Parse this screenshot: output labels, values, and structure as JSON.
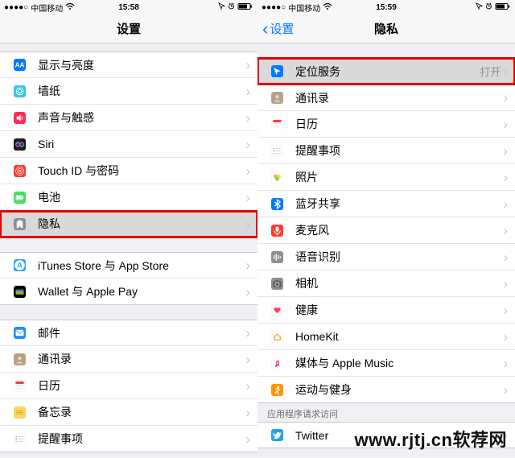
{
  "status_left": {
    "dots": "●●●●○",
    "carrier": "中国移动",
    "wifi": "wifi"
  },
  "status_right": {
    "icons": "◎ ➚ ⏰ ▮▯"
  },
  "left": {
    "time": "15:58",
    "title": "设置",
    "groups": [
      [
        {
          "icon": "display",
          "color": "#007aff",
          "label": "显示与亮度"
        },
        {
          "icon": "wallpaper",
          "color": "#38c5e6",
          "label": "墙纸"
        },
        {
          "icon": "sound",
          "color": "#ff2d55",
          "label": "声音与触感"
        },
        {
          "icon": "siri",
          "color": "grad-siri",
          "label": "Siri"
        },
        {
          "icon": "touchid",
          "color": "#ff3b30",
          "label": "Touch ID 与密码"
        },
        {
          "icon": "battery",
          "color": "#4cd964",
          "label": "电池"
        },
        {
          "icon": "privacy",
          "color": "#8e8e93",
          "label": "隐私",
          "highlight": true,
          "selected": true
        }
      ],
      [
        {
          "icon": "appstore",
          "color": "#1fa7ff",
          "label": "iTunes Store 与 App Store"
        },
        {
          "icon": "wallet",
          "color": "#000000",
          "label": "Wallet 与 Apple Pay"
        }
      ],
      [
        {
          "icon": "mail",
          "color": "#1f8ef4",
          "label": "邮件"
        },
        {
          "icon": "contacts",
          "color": "#b8a38b",
          "label": "通讯录"
        },
        {
          "icon": "calendar",
          "color": "#ffffff",
          "label": "日历"
        },
        {
          "icon": "notes",
          "color": "#fcd55f",
          "label": "备忘录"
        },
        {
          "icon": "reminders",
          "color": "#ffffff",
          "label": "提醒事项"
        }
      ]
    ]
  },
  "right": {
    "time": "15:59",
    "back": "设置",
    "title": "隐私",
    "groups": [
      [
        {
          "icon": "location",
          "color": "#007aff",
          "label": "定位服务",
          "value": "打开",
          "highlight": true,
          "selected": true
        }
      ],
      [
        {
          "icon": "contacts",
          "color": "#b8a38b",
          "label": "通讯录"
        },
        {
          "icon": "calendar",
          "color": "#ffffff",
          "label": "日历"
        },
        {
          "icon": "reminders",
          "color": "#ffffff",
          "label": "提醒事项"
        },
        {
          "icon": "photos",
          "color": "#ffffff",
          "label": "照片"
        },
        {
          "icon": "bluetooth",
          "color": "#007aff",
          "label": "蓝牙共享"
        },
        {
          "icon": "mic",
          "color": "#ff3b30",
          "label": "麦克风"
        },
        {
          "icon": "speech",
          "color": "#8e8e93",
          "label": "语音识别"
        },
        {
          "icon": "camera",
          "color": "#8e8e93",
          "label": "相机"
        },
        {
          "icon": "health",
          "color": "#ffffff",
          "label": "健康"
        },
        {
          "icon": "homekit",
          "color": "#ffffff",
          "label": "HomeKit"
        },
        {
          "icon": "music",
          "color": "#ffffff",
          "label": "媒体与 Apple Music"
        },
        {
          "icon": "motion",
          "color": "#ff9500",
          "label": "运动与健身"
        }
      ]
    ],
    "footer_visible": "应用程序请求访问",
    "extra_row": {
      "icon": "twitter",
      "color": "#1da1f2",
      "label": "Twitter"
    }
  },
  "watermark": "www.rjtj.cn软荐网"
}
